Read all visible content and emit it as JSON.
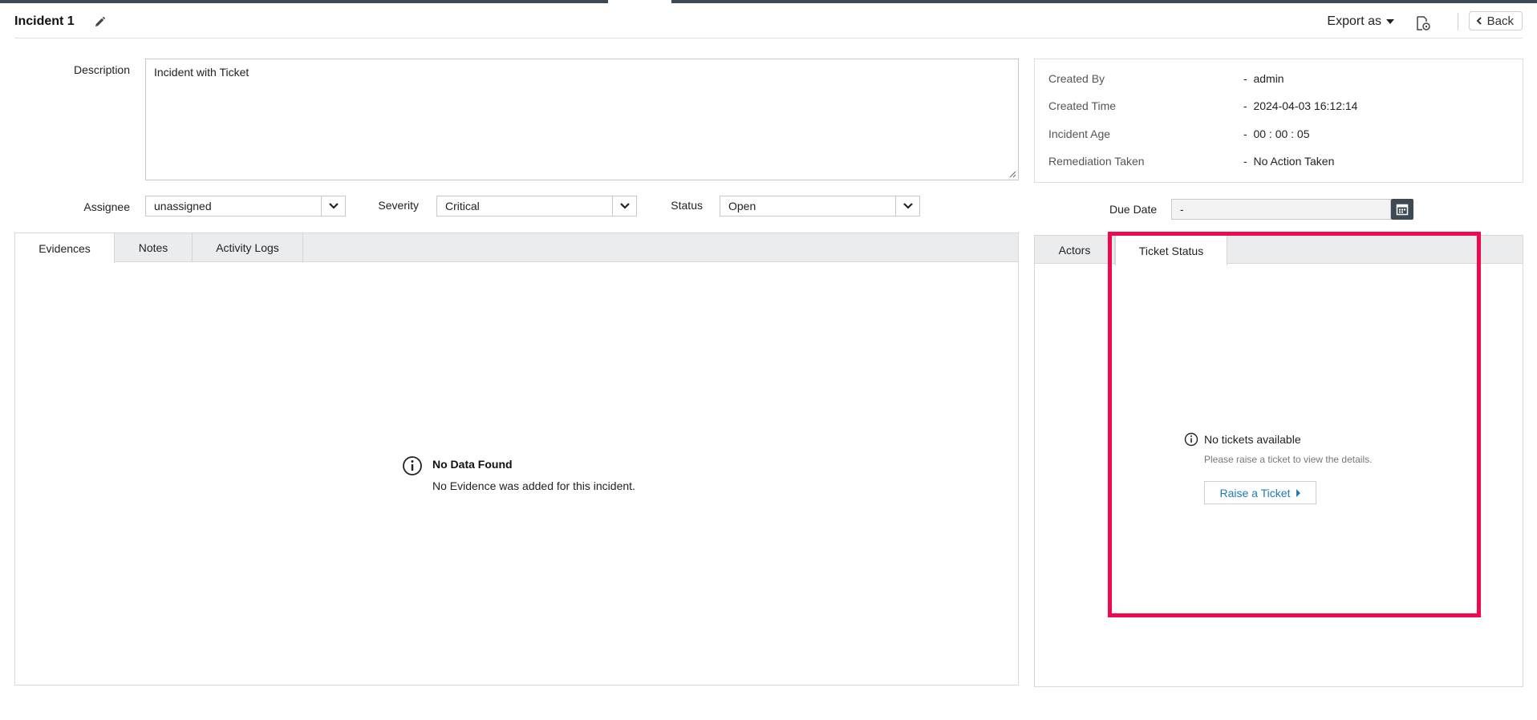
{
  "header": {
    "title": "Incident 1",
    "export_label": "Export as",
    "back_label": "Back"
  },
  "form": {
    "description_label": "Description",
    "description_value": "Incident with Ticket",
    "assignee_label": "Assignee",
    "assignee_value": "unassigned",
    "severity_label": "Severity",
    "severity_value": "Critical",
    "status_label": "Status",
    "status_value": "Open"
  },
  "info": {
    "created_by_label": "Created By",
    "created_by_value": "admin",
    "created_time_label": "Created Time",
    "created_time_value": "2024-04-03 16:12:14",
    "incident_age_label": "Incident Age",
    "incident_age_value": "00 : 00 : 05",
    "remediation_label": "Remediation Taken",
    "remediation_value": "No Action Taken",
    "separator": "-"
  },
  "due_date": {
    "label": "Due Date",
    "value": "-"
  },
  "left_tabs": {
    "items": [
      "Evidences",
      "Notes",
      "Activity Logs"
    ],
    "active": "Evidences"
  },
  "evidences_empty": {
    "title": "No Data Found",
    "message": "No Evidence was added for this incident."
  },
  "right_tabs": {
    "items": [
      "Actors",
      "Ticket Status"
    ],
    "active": "Ticket Status"
  },
  "ticket_empty": {
    "title": "No tickets available",
    "message": "Please raise a ticket to view the details.",
    "button_label": "Raise a Ticket"
  },
  "colors": {
    "topbar": "#3d4a53",
    "highlight": "#f0094f",
    "link": "#1f7ab8"
  }
}
